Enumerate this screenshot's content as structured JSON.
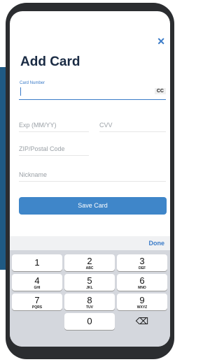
{
  "header": {
    "close_glyph": "✕",
    "title": "Add Card"
  },
  "form": {
    "card_number_label": "Card Number",
    "card_badge": "CC",
    "expiry_placeholder": "Exp (MM/YY)",
    "cvv_placeholder": "CVV",
    "zip_placeholder": "ZIP/Postal Code",
    "nickname_placeholder": "Nickname",
    "save_label": "Save Card"
  },
  "keyboard": {
    "done_label": "Done",
    "keys": [
      {
        "digit": "1",
        "letters": ""
      },
      {
        "digit": "2",
        "letters": "ABC"
      },
      {
        "digit": "3",
        "letters": "DEF"
      },
      {
        "digit": "4",
        "letters": "GHI"
      },
      {
        "digit": "5",
        "letters": "JKL"
      },
      {
        "digit": "6",
        "letters": "MNO"
      },
      {
        "digit": "7",
        "letters": "PQRS"
      },
      {
        "digit": "8",
        "letters": "TUV"
      },
      {
        "digit": "9",
        "letters": "WXYZ"
      },
      {
        "digit": "0",
        "letters": ""
      }
    ],
    "backspace_glyph": "⌫"
  },
  "colors": {
    "accent": "#3a7bc8",
    "button": "#3f86c9",
    "title": "#1a2b44"
  }
}
